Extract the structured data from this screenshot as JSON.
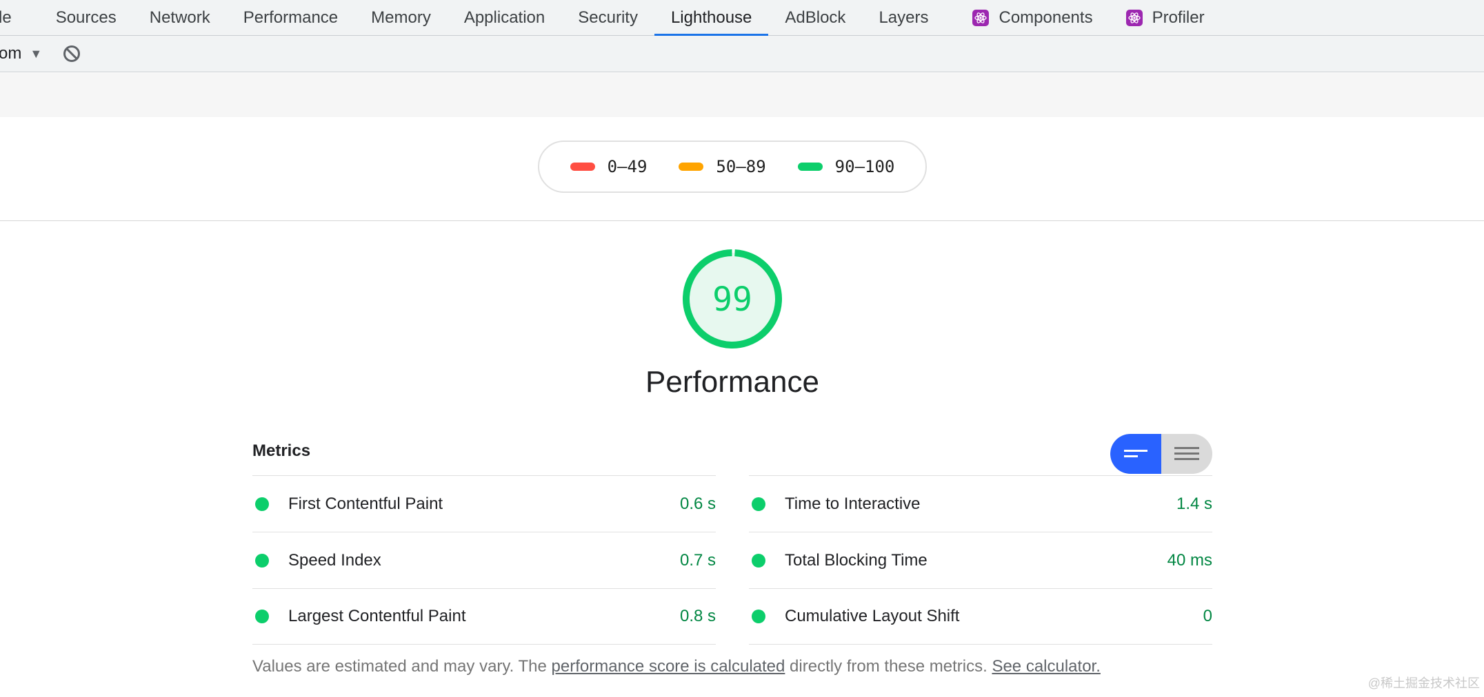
{
  "tabs": [
    {
      "label": "le",
      "active": false
    },
    {
      "label": "Sources",
      "active": false
    },
    {
      "label": "Network",
      "active": false
    },
    {
      "label": "Performance",
      "active": false
    },
    {
      "label": "Memory",
      "active": false
    },
    {
      "label": "Application",
      "active": false
    },
    {
      "label": "Security",
      "active": false
    },
    {
      "label": "Lighthouse",
      "active": true
    },
    {
      "label": "AdBlock",
      "active": false
    },
    {
      "label": "Layers",
      "active": false
    },
    {
      "label": "Components",
      "active": false,
      "icon": "react-icon"
    },
    {
      "label": "Profiler",
      "active": false,
      "icon": "react-icon"
    }
  ],
  "toolbar": {
    "url_fragment": "om",
    "caret": "▼",
    "clear_icon": "block-icon"
  },
  "legend": [
    {
      "range": "0–49",
      "color": "#ff4e42"
    },
    {
      "range": "50–89",
      "color": "#ffa400"
    },
    {
      "range": "90–100",
      "color": "#0cce6b"
    }
  ],
  "gauge": {
    "score": "99",
    "fraction": 0.99,
    "color": "#0cce6b",
    "fill": "#e7f8ef"
  },
  "category": {
    "title": "Performance"
  },
  "metrics": {
    "title": "Metrics",
    "left": [
      {
        "name": "First Contentful Paint",
        "value": "0.6 s"
      },
      {
        "name": "Speed Index",
        "value": "0.7 s"
      },
      {
        "name": "Largest Contentful Paint",
        "value": "0.8 s"
      }
    ],
    "right": [
      {
        "name": "Time to Interactive",
        "value": "1.4 s"
      },
      {
        "name": "Total Blocking Time",
        "value": "40 ms"
      },
      {
        "name": "Cumulative Layout Shift",
        "value": "0"
      }
    ],
    "status_color": "#0cce6b",
    "toggle_active_color": "#2962ff"
  },
  "footnote": {
    "prefix": "Values are estimated and may vary. The ",
    "link1": "performance score is calculated",
    "middle": " directly from these metrics. ",
    "link2": "See calculator."
  },
  "watermark": "@稀土掘金技术社区"
}
